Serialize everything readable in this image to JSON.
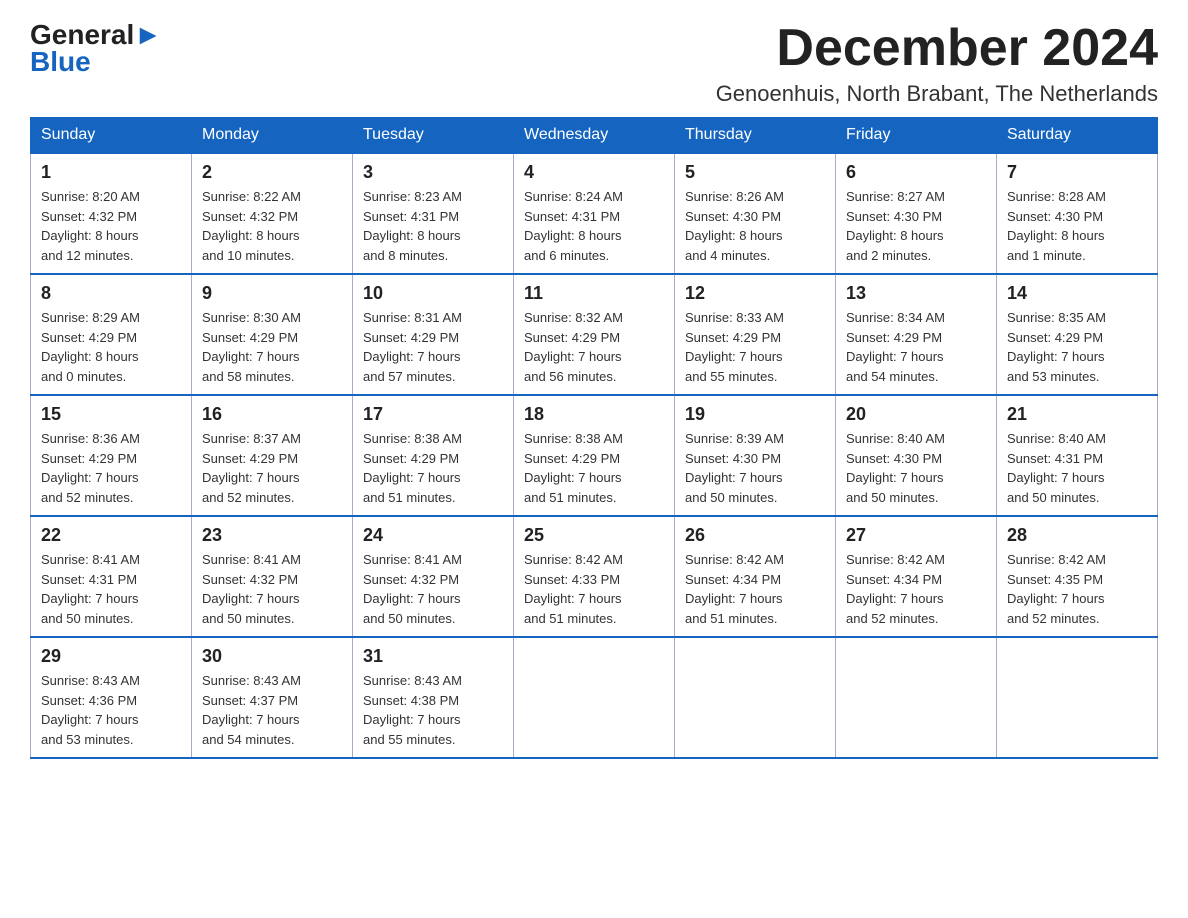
{
  "logo": {
    "text_general": "General",
    "text_blue": "Blue",
    "subtext": "Blue"
  },
  "title": "December 2024",
  "subtitle": "Genoenhuis, North Brabant, The Netherlands",
  "days_header": [
    "Sunday",
    "Monday",
    "Tuesday",
    "Wednesday",
    "Thursday",
    "Friday",
    "Saturday"
  ],
  "weeks": [
    [
      {
        "day": "1",
        "sunrise": "Sunrise: 8:20 AM",
        "sunset": "Sunset: 4:32 PM",
        "daylight": "Daylight: 8 hours",
        "daylight2": "and 12 minutes."
      },
      {
        "day": "2",
        "sunrise": "Sunrise: 8:22 AM",
        "sunset": "Sunset: 4:32 PM",
        "daylight": "Daylight: 8 hours",
        "daylight2": "and 10 minutes."
      },
      {
        "day": "3",
        "sunrise": "Sunrise: 8:23 AM",
        "sunset": "Sunset: 4:31 PM",
        "daylight": "Daylight: 8 hours",
        "daylight2": "and 8 minutes."
      },
      {
        "day": "4",
        "sunrise": "Sunrise: 8:24 AM",
        "sunset": "Sunset: 4:31 PM",
        "daylight": "Daylight: 8 hours",
        "daylight2": "and 6 minutes."
      },
      {
        "day": "5",
        "sunrise": "Sunrise: 8:26 AM",
        "sunset": "Sunset: 4:30 PM",
        "daylight": "Daylight: 8 hours",
        "daylight2": "and 4 minutes."
      },
      {
        "day": "6",
        "sunrise": "Sunrise: 8:27 AM",
        "sunset": "Sunset: 4:30 PM",
        "daylight": "Daylight: 8 hours",
        "daylight2": "and 2 minutes."
      },
      {
        "day": "7",
        "sunrise": "Sunrise: 8:28 AM",
        "sunset": "Sunset: 4:30 PM",
        "daylight": "Daylight: 8 hours",
        "daylight2": "and 1 minute."
      }
    ],
    [
      {
        "day": "8",
        "sunrise": "Sunrise: 8:29 AM",
        "sunset": "Sunset: 4:29 PM",
        "daylight": "Daylight: 8 hours",
        "daylight2": "and 0 minutes."
      },
      {
        "day": "9",
        "sunrise": "Sunrise: 8:30 AM",
        "sunset": "Sunset: 4:29 PM",
        "daylight": "Daylight: 7 hours",
        "daylight2": "and 58 minutes."
      },
      {
        "day": "10",
        "sunrise": "Sunrise: 8:31 AM",
        "sunset": "Sunset: 4:29 PM",
        "daylight": "Daylight: 7 hours",
        "daylight2": "and 57 minutes."
      },
      {
        "day": "11",
        "sunrise": "Sunrise: 8:32 AM",
        "sunset": "Sunset: 4:29 PM",
        "daylight": "Daylight: 7 hours",
        "daylight2": "and 56 minutes."
      },
      {
        "day": "12",
        "sunrise": "Sunrise: 8:33 AM",
        "sunset": "Sunset: 4:29 PM",
        "daylight": "Daylight: 7 hours",
        "daylight2": "and 55 minutes."
      },
      {
        "day": "13",
        "sunrise": "Sunrise: 8:34 AM",
        "sunset": "Sunset: 4:29 PM",
        "daylight": "Daylight: 7 hours",
        "daylight2": "and 54 minutes."
      },
      {
        "day": "14",
        "sunrise": "Sunrise: 8:35 AM",
        "sunset": "Sunset: 4:29 PM",
        "daylight": "Daylight: 7 hours",
        "daylight2": "and 53 minutes."
      }
    ],
    [
      {
        "day": "15",
        "sunrise": "Sunrise: 8:36 AM",
        "sunset": "Sunset: 4:29 PM",
        "daylight": "Daylight: 7 hours",
        "daylight2": "and 52 minutes."
      },
      {
        "day": "16",
        "sunrise": "Sunrise: 8:37 AM",
        "sunset": "Sunset: 4:29 PM",
        "daylight": "Daylight: 7 hours",
        "daylight2": "and 52 minutes."
      },
      {
        "day": "17",
        "sunrise": "Sunrise: 8:38 AM",
        "sunset": "Sunset: 4:29 PM",
        "daylight": "Daylight: 7 hours",
        "daylight2": "and 51 minutes."
      },
      {
        "day": "18",
        "sunrise": "Sunrise: 8:38 AM",
        "sunset": "Sunset: 4:29 PM",
        "daylight": "Daylight: 7 hours",
        "daylight2": "and 51 minutes."
      },
      {
        "day": "19",
        "sunrise": "Sunrise: 8:39 AM",
        "sunset": "Sunset: 4:30 PM",
        "daylight": "Daylight: 7 hours",
        "daylight2": "and 50 minutes."
      },
      {
        "day": "20",
        "sunrise": "Sunrise: 8:40 AM",
        "sunset": "Sunset: 4:30 PM",
        "daylight": "Daylight: 7 hours",
        "daylight2": "and 50 minutes."
      },
      {
        "day": "21",
        "sunrise": "Sunrise: 8:40 AM",
        "sunset": "Sunset: 4:31 PM",
        "daylight": "Daylight: 7 hours",
        "daylight2": "and 50 minutes."
      }
    ],
    [
      {
        "day": "22",
        "sunrise": "Sunrise: 8:41 AM",
        "sunset": "Sunset: 4:31 PM",
        "daylight": "Daylight: 7 hours",
        "daylight2": "and 50 minutes."
      },
      {
        "day": "23",
        "sunrise": "Sunrise: 8:41 AM",
        "sunset": "Sunset: 4:32 PM",
        "daylight": "Daylight: 7 hours",
        "daylight2": "and 50 minutes."
      },
      {
        "day": "24",
        "sunrise": "Sunrise: 8:41 AM",
        "sunset": "Sunset: 4:32 PM",
        "daylight": "Daylight: 7 hours",
        "daylight2": "and 50 minutes."
      },
      {
        "day": "25",
        "sunrise": "Sunrise: 8:42 AM",
        "sunset": "Sunset: 4:33 PM",
        "daylight": "Daylight: 7 hours",
        "daylight2": "and 51 minutes."
      },
      {
        "day": "26",
        "sunrise": "Sunrise: 8:42 AM",
        "sunset": "Sunset: 4:34 PM",
        "daylight": "Daylight: 7 hours",
        "daylight2": "and 51 minutes."
      },
      {
        "day": "27",
        "sunrise": "Sunrise: 8:42 AM",
        "sunset": "Sunset: 4:34 PM",
        "daylight": "Daylight: 7 hours",
        "daylight2": "and 52 minutes."
      },
      {
        "day": "28",
        "sunrise": "Sunrise: 8:42 AM",
        "sunset": "Sunset: 4:35 PM",
        "daylight": "Daylight: 7 hours",
        "daylight2": "and 52 minutes."
      }
    ],
    [
      {
        "day": "29",
        "sunrise": "Sunrise: 8:43 AM",
        "sunset": "Sunset: 4:36 PM",
        "daylight": "Daylight: 7 hours",
        "daylight2": "and 53 minutes."
      },
      {
        "day": "30",
        "sunrise": "Sunrise: 8:43 AM",
        "sunset": "Sunset: 4:37 PM",
        "daylight": "Daylight: 7 hours",
        "daylight2": "and 54 minutes."
      },
      {
        "day": "31",
        "sunrise": "Sunrise: 8:43 AM",
        "sunset": "Sunset: 4:38 PM",
        "daylight": "Daylight: 7 hours",
        "daylight2": "and 55 minutes."
      },
      null,
      null,
      null,
      null
    ]
  ]
}
